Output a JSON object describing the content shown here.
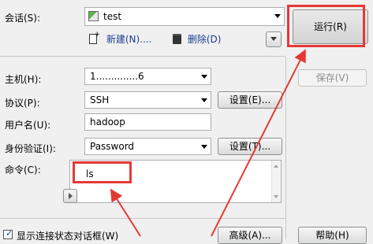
{
  "session": {
    "label": "会话(S):",
    "selected": "test",
    "new_label": "新建(N)....",
    "delete_label": "删除(D)"
  },
  "actions": {
    "run_label": "运行(R)",
    "save_label": "保存(V)",
    "help_label": "帮助(H)"
  },
  "host": {
    "label": "主机(H):",
    "value": "1..............6"
  },
  "protocol": {
    "label": "协议(P):",
    "value": "SSH",
    "settings_label": "设置(E)..."
  },
  "username": {
    "label": "用户名(U):",
    "value": "hadoop"
  },
  "auth": {
    "label": "身份验证(I):",
    "value": "Password",
    "settings_label": "设置(T)..."
  },
  "command": {
    "label": "命令(C):",
    "value": "ls"
  },
  "footer": {
    "show_dialog_label": "显示连接状态对话框(W)",
    "show_dialog_checked": true,
    "advanced_label": "高级(A)..."
  },
  "colors": {
    "highlight": "#e53935",
    "window_bg": "#f0f0f0"
  }
}
